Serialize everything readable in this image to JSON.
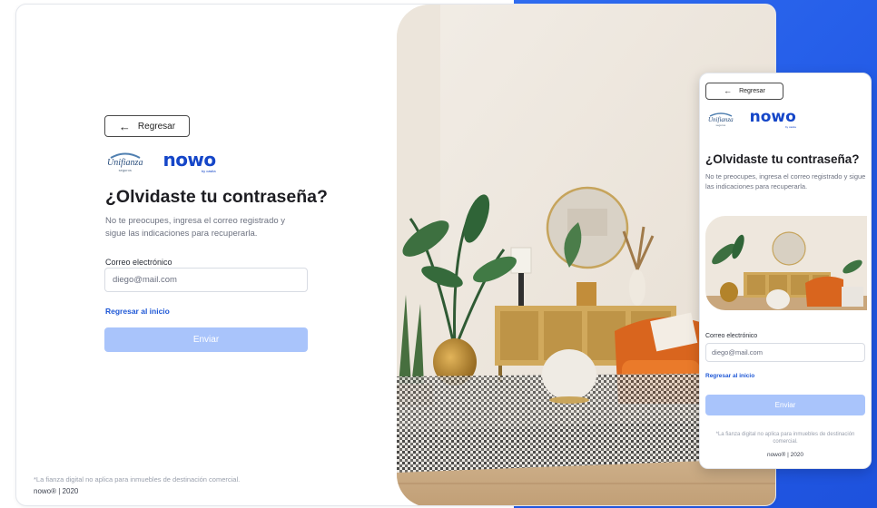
{
  "back_label": "Regresar",
  "logos": {
    "unifianza": "Unifianza",
    "unifianza_tagline": "seguros",
    "nowo": "nowo",
    "nowo_sub": "by casita"
  },
  "title": "¿Olvidaste tu contraseña?",
  "description": "No te preocupes, ingresa el correo registrado y sigue las indicaciones para recuperarla.",
  "email": {
    "label": "Correo electrónico",
    "value": "diego@mail.com"
  },
  "back_to_start": "Regresar al inicio",
  "submit_label": "Enviar",
  "disclaimer": "*La fianza digital no aplica para inmuebles de destinación comercial.",
  "copyright": "nowo® | 2020",
  "colors": {
    "brand_blue": "#1546c8",
    "background_blue": "#2259e6",
    "button_disabled": "#a9c4fb",
    "link": "#1f58d6"
  }
}
